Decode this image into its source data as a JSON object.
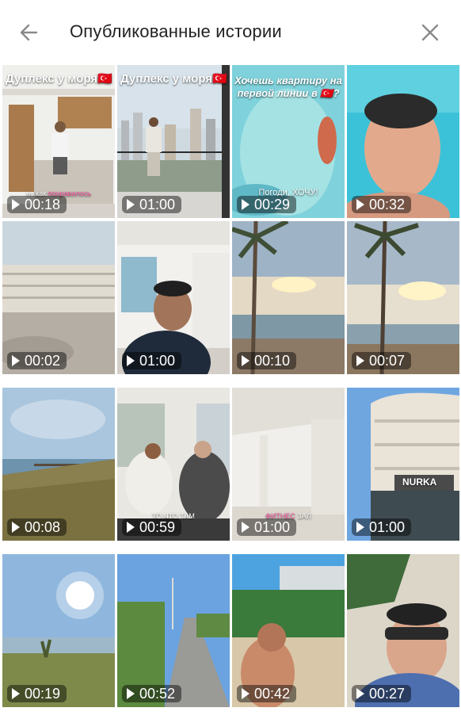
{
  "header": {
    "title": "Опубликованные истории",
    "back_icon": "arrow-left-icon",
    "close_icon": "close-icon"
  },
  "colors": {
    "header_text": "#222222",
    "icon": "#8a8a8a",
    "duration_badge": "rgba(0,0,0,0.45)"
  },
  "stories": [
    {
      "caption": "Дуплекс у моря🇹🇷",
      "subcaption_pre": "ну как ",
      "subcaption_hl": "понравилось",
      "duration": "00:18"
    },
    {
      "caption": "Дуплекс у моря🇹🇷",
      "duration": "01:00"
    },
    {
      "caption": "Хочешь квартиру на первой линии в 🇹🇷?",
      "subcaption_pre": "Погоди, ",
      "subcaption_hl": "",
      "subcaption_post": "ХОЧУ!",
      "duration": "00:29"
    },
    {
      "duration": "00:32"
    },
    {
      "duration": "00:02"
    },
    {
      "duration": "01:00"
    },
    {
      "duration": "00:10"
    },
    {
      "duration": "00:07"
    },
    {
      "duration": "00:08"
    },
    {
      "subcaption_pre": "ТО ЧТО ТАМ",
      "duration": "00:59"
    },
    {
      "subcaption_hl": "ФИТНЕС",
      "subcaption_post": " ЗАЛ",
      "duration": "01:00"
    },
    {
      "sign": "NURKA",
      "duration": "01:00"
    },
    {
      "duration": "00:19"
    },
    {
      "duration": "00:52"
    },
    {
      "duration": "00:42"
    },
    {
      "duration": "00:27"
    }
  ]
}
